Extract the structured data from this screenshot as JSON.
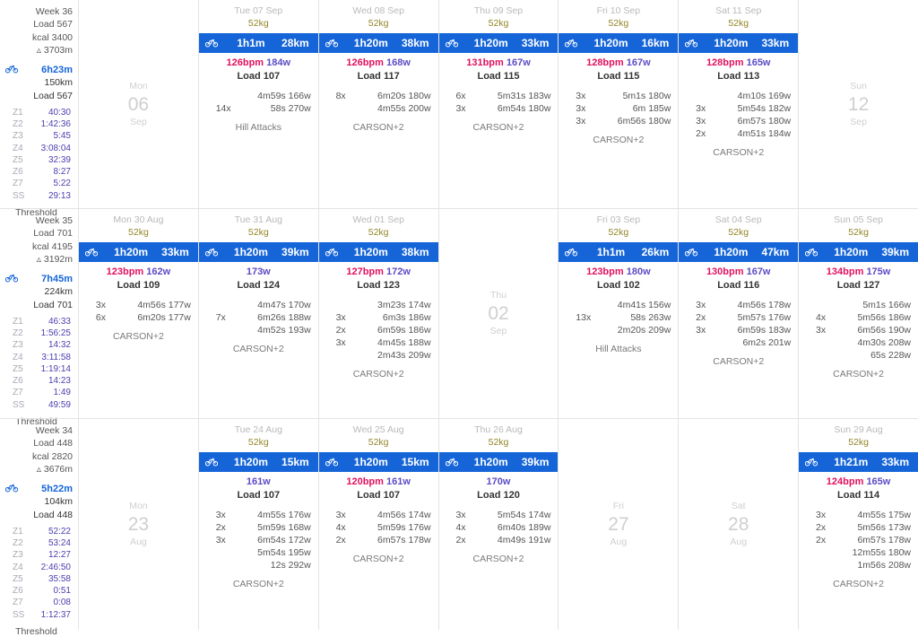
{
  "icons": {
    "bike": "bike-icon",
    "elevation": "▵"
  },
  "colors": {
    "accent": "#1565d8",
    "hr": "#e0115f",
    "power": "#5b4cc4",
    "weight": "#938528",
    "zone_value": "#4b3fae",
    "muted": "#b9b9b9"
  },
  "weeks": [
    {
      "summary": {
        "week": "Week 36",
        "load": "Load 567",
        "kcal": "kcal 3400",
        "elevation": "▵ 3703m",
        "sport_duration": "6h23m",
        "sport_distance": "150km",
        "sport_load": "Load 567",
        "zones": [
          {
            "label": "Z1",
            "value": "40:30"
          },
          {
            "label": "Z2",
            "value": "1:42:36"
          },
          {
            "label": "Z3",
            "value": "5:45"
          },
          {
            "label": "Z4",
            "value": "3:08:04"
          },
          {
            "label": "Z5",
            "value": "32:39"
          },
          {
            "label": "Z6",
            "value": "8:27"
          },
          {
            "label": "Z7",
            "value": "5:22"
          },
          {
            "label": "SS",
            "value": "29:13"
          }
        ],
        "threshold": "Threshold"
      },
      "days": [
        {
          "date_full": "Mon 06 Sep",
          "empty": true,
          "dow": "Mon",
          "daynum": "06",
          "month": "Sep"
        },
        {
          "date_full": "Tue 07 Sep",
          "empty": false,
          "weight": "52kg",
          "duration": "1h1m",
          "distance": "28km",
          "bpm": "126bpm",
          "power": "184w",
          "load": "Load 107",
          "intervals": [
            {
              "rep": "",
              "body": "4m59s 166w"
            },
            {
              "rep": "14x",
              "body": "58s 270w"
            }
          ],
          "workout": "Hill Attacks"
        },
        {
          "date_full": "Wed 08 Sep",
          "empty": false,
          "weight": "52kg",
          "duration": "1h20m",
          "distance": "38km",
          "bpm": "126bpm",
          "power": "168w",
          "load": "Load 117",
          "intervals": [
            {
              "rep": "8x",
              "body": "6m20s 180w"
            },
            {
              "rep": "",
              "body": "4m55s 200w"
            }
          ],
          "workout": "CARSON+2"
        },
        {
          "date_full": "Thu 09 Sep",
          "empty": false,
          "weight": "52kg",
          "duration": "1h20m",
          "distance": "33km",
          "bpm": "131bpm",
          "power": "167w",
          "load": "Load 115",
          "intervals": [
            {
              "rep": "6x",
              "body": "5m31s 183w"
            },
            {
              "rep": "3x",
              "body": "6m54s 180w"
            }
          ],
          "workout": "CARSON+2"
        },
        {
          "date_full": "Fri 10 Sep",
          "empty": false,
          "weight": "52kg",
          "duration": "1h20m",
          "distance": "16km",
          "bpm": "128bpm",
          "power": "167w",
          "load": "Load 115",
          "intervals": [
            {
              "rep": "3x",
              "body": "5m1s 180w"
            },
            {
              "rep": "3x",
              "body": "6m 185w"
            },
            {
              "rep": "3x",
              "body": "6m56s 180w"
            }
          ],
          "workout": "CARSON+2"
        },
        {
          "date_full": "Sat 11 Sep",
          "empty": false,
          "weight": "52kg",
          "duration": "1h20m",
          "distance": "33km",
          "bpm": "128bpm",
          "power": "165w",
          "load": "Load 113",
          "intervals": [
            {
              "rep": "",
              "body": "4m10s 169w"
            },
            {
              "rep": "3x",
              "body": "5m54s 182w"
            },
            {
              "rep": "3x",
              "body": "6m57s 180w"
            },
            {
              "rep": "2x",
              "body": "4m51s 184w"
            }
          ],
          "workout": "CARSON+2"
        },
        {
          "date_full": "Sun 12 Sep",
          "empty": true,
          "dow": "Sun",
          "daynum": "12",
          "month": "Sep"
        }
      ]
    },
    {
      "summary": {
        "week": "Week 35",
        "load": "Load 701",
        "kcal": "kcal 4195",
        "elevation": "▵ 3192m",
        "sport_duration": "7h45m",
        "sport_distance": "224km",
        "sport_load": "Load 701",
        "zones": [
          {
            "label": "Z1",
            "value": "46:33"
          },
          {
            "label": "Z2",
            "value": "1:56:25"
          },
          {
            "label": "Z3",
            "value": "14:32"
          },
          {
            "label": "Z4",
            "value": "3:11:58"
          },
          {
            "label": "Z5",
            "value": "1:19:14"
          },
          {
            "label": "Z6",
            "value": "14:23"
          },
          {
            "label": "Z7",
            "value": "1:49"
          },
          {
            "label": "SS",
            "value": "49:59"
          }
        ],
        "threshold": "Threshold"
      },
      "days": [
        {
          "date_full": "Mon 30 Aug",
          "empty": false,
          "weight": "52kg",
          "duration": "1h20m",
          "distance": "33km",
          "bpm": "123bpm",
          "power": "162w",
          "load": "Load 109",
          "intervals": [
            {
              "rep": "3x",
              "body": "4m56s 177w"
            },
            {
              "rep": "6x",
              "body": "6m20s 177w"
            }
          ],
          "workout": "CARSON+2"
        },
        {
          "date_full": "Tue 31 Aug",
          "empty": false,
          "weight": "52kg",
          "duration": "1h20m",
          "distance": "39km",
          "bpm": "",
          "power": "173w",
          "load": "Load 124",
          "intervals": [
            {
              "rep": "",
              "body": "4m47s 170w"
            },
            {
              "rep": "7x",
              "body": "6m26s 188w"
            },
            {
              "rep": "",
              "body": "4m52s 193w"
            }
          ],
          "workout": "CARSON+2"
        },
        {
          "date_full": "Wed 01 Sep",
          "empty": false,
          "weight": "52kg",
          "duration": "1h20m",
          "distance": "38km",
          "bpm": "127bpm",
          "power": "172w",
          "load": "Load 123",
          "intervals": [
            {
              "rep": "",
              "body": "3m23s 174w"
            },
            {
              "rep": "3x",
              "body": "6m3s 186w"
            },
            {
              "rep": "2x",
              "body": "6m59s 186w"
            },
            {
              "rep": "3x",
              "body": "4m45s 188w"
            },
            {
              "rep": "",
              "body": "2m43s 209w"
            }
          ],
          "workout": "CARSON+2"
        },
        {
          "date_full": "Thu 02 Sep",
          "empty": true,
          "dow": "Thu",
          "daynum": "02",
          "month": "Sep"
        },
        {
          "date_full": "Fri 03 Sep",
          "empty": false,
          "weight": "52kg",
          "duration": "1h1m",
          "distance": "26km",
          "bpm": "123bpm",
          "power": "180w",
          "load": "Load 102",
          "intervals": [
            {
              "rep": "",
              "body": "4m41s 156w"
            },
            {
              "rep": "13x",
              "body": "58s 263w"
            },
            {
              "rep": "",
              "body": "2m20s 209w"
            }
          ],
          "workout": "Hill Attacks"
        },
        {
          "date_full": "Sat 04 Sep",
          "empty": false,
          "weight": "52kg",
          "duration": "1h20m",
          "distance": "47km",
          "bpm": "130bpm",
          "power": "167w",
          "load": "Load 116",
          "intervals": [
            {
              "rep": "3x",
              "body": "4m56s 178w"
            },
            {
              "rep": "2x",
              "body": "5m57s 176w"
            },
            {
              "rep": "3x",
              "body": "6m59s 183w"
            },
            {
              "rep": "",
              "body": "6m2s 201w"
            }
          ],
          "workout": "CARSON+2"
        },
        {
          "date_full": "Sun 05 Sep",
          "empty": false,
          "weight": "52kg",
          "duration": "1h20m",
          "distance": "39km",
          "bpm": "134bpm",
          "power": "175w",
          "load": "Load 127",
          "intervals": [
            {
              "rep": "",
              "body": "5m1s 166w"
            },
            {
              "rep": "4x",
              "body": "5m56s 186w"
            },
            {
              "rep": "3x",
              "body": "6m56s 190w"
            },
            {
              "rep": "",
              "body": "4m30s 208w"
            },
            {
              "rep": "",
              "body": "65s 228w"
            }
          ],
          "workout": "CARSON+2"
        }
      ]
    },
    {
      "summary": {
        "week": "Week 34",
        "load": "Load 448",
        "kcal": "kcal 2820",
        "elevation": "▵ 3676m",
        "sport_duration": "5h22m",
        "sport_distance": "104km",
        "sport_load": "Load 448",
        "zones": [
          {
            "label": "Z1",
            "value": "52:22"
          },
          {
            "label": "Z2",
            "value": "53:24"
          },
          {
            "label": "Z3",
            "value": "12:27"
          },
          {
            "label": "Z4",
            "value": "2:46:50"
          },
          {
            "label": "Z5",
            "value": "35:58"
          },
          {
            "label": "Z6",
            "value": "0:51"
          },
          {
            "label": "Z7",
            "value": "0:08"
          },
          {
            "label": "SS",
            "value": "1:12:37"
          }
        ],
        "threshold": "Threshold"
      },
      "days": [
        {
          "date_full": "Mon 23 Aug",
          "empty": true,
          "dow": "Mon",
          "daynum": "23",
          "month": "Aug"
        },
        {
          "date_full": "Tue 24 Aug",
          "empty": false,
          "weight": "52kg",
          "duration": "1h20m",
          "distance": "15km",
          "bpm": "",
          "power": "161w",
          "load": "Load 107",
          "intervals": [
            {
              "rep": "3x",
              "body": "4m55s 176w"
            },
            {
              "rep": "2x",
              "body": "5m59s 168w"
            },
            {
              "rep": "3x",
              "body": "6m54s 172w"
            },
            {
              "rep": "",
              "body": "5m54s 195w"
            },
            {
              "rep": "",
              "body": "12s 292w"
            }
          ],
          "workout": "CARSON+2"
        },
        {
          "date_full": "Wed 25 Aug",
          "empty": false,
          "weight": "52kg",
          "duration": "1h20m",
          "distance": "15km",
          "bpm": "120bpm",
          "power": "161w",
          "load": "Load 107",
          "intervals": [
            {
              "rep": "3x",
              "body": "4m56s 174w"
            },
            {
              "rep": "4x",
              "body": "5m59s 176w"
            },
            {
              "rep": "2x",
              "body": "6m57s 178w"
            }
          ],
          "workout": "CARSON+2"
        },
        {
          "date_full": "Thu 26 Aug",
          "empty": false,
          "weight": "52kg",
          "duration": "1h20m",
          "distance": "39km",
          "bpm": "",
          "power": "170w",
          "load": "Load 120",
          "intervals": [
            {
              "rep": "3x",
              "body": "5m54s 174w"
            },
            {
              "rep": "4x",
              "body": "6m40s 189w"
            },
            {
              "rep": "2x",
              "body": "4m49s 191w"
            }
          ],
          "workout": "CARSON+2"
        },
        {
          "date_full": "Fri 27 Aug",
          "empty": true,
          "dow": "Fri",
          "daynum": "27",
          "month": "Aug"
        },
        {
          "date_full": "Sat 28 Aug",
          "empty": true,
          "dow": "Sat",
          "daynum": "28",
          "month": "Aug"
        },
        {
          "date_full": "Sun 29 Aug",
          "empty": false,
          "weight": "52kg",
          "duration": "1h21m",
          "distance": "33km",
          "bpm": "124bpm",
          "power": "165w",
          "load": "Load 114",
          "intervals": [
            {
              "rep": "3x",
              "body": "4m55s 175w"
            },
            {
              "rep": "2x",
              "body": "5m56s 173w"
            },
            {
              "rep": "2x",
              "body": "6m57s 178w"
            },
            {
              "rep": "",
              "body": "12m55s 180w"
            },
            {
              "rep": "",
              "body": "1m56s 208w"
            }
          ],
          "workout": "CARSON+2"
        }
      ]
    }
  ]
}
